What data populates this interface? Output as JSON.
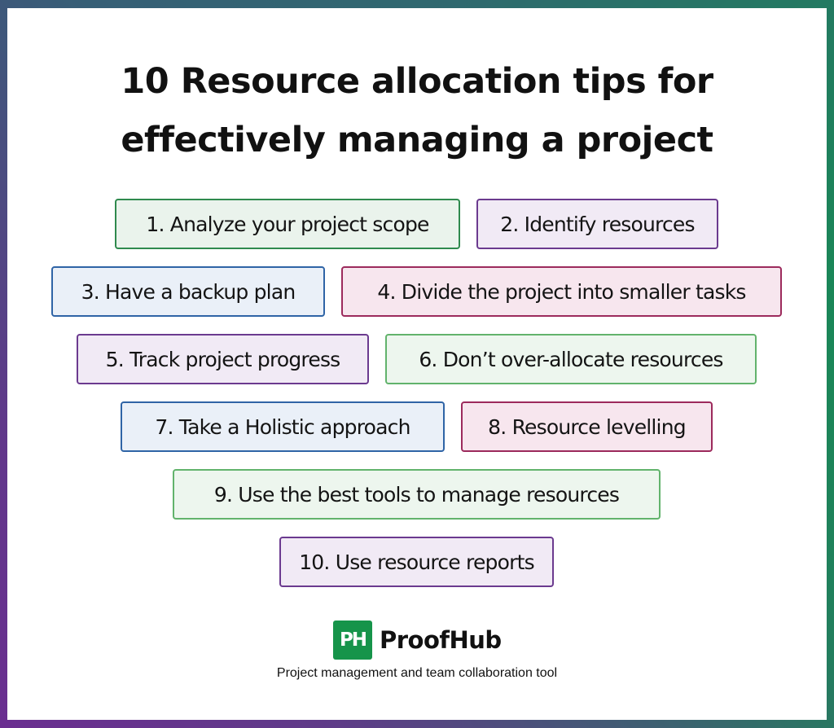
{
  "title": {
    "line1": "10 Resource allocation tips for",
    "line2": "effectively managing a project"
  },
  "tips": [
    {
      "label": "1.  Analyze your project scope",
      "color": "green"
    },
    {
      "label": "2.  Identify resources",
      "color": "purple"
    },
    {
      "label": "3.  Have a backup plan",
      "color": "blue"
    },
    {
      "label": "4.  Divide the project into smaller tasks",
      "color": "pink"
    },
    {
      "label": "5.  Track project progress",
      "color": "purple"
    },
    {
      "label": "6.  Don’t over-allocate resources",
      "color": "green"
    },
    {
      "label": "7.  Take a Holistic approach",
      "color": "blue"
    },
    {
      "label": "8.  Resource levelling",
      "color": "pink"
    },
    {
      "label": "9.   Use the best tools to manage resources",
      "color": "green"
    },
    {
      "label": "10. Use resource reports",
      "color": "purple"
    }
  ],
  "brand": {
    "logo_mark": "PH",
    "name": "ProofHub",
    "tagline": "Project management and team collaboration tool",
    "color": "#16944a"
  },
  "colors": {
    "border_top_left": "#2e6a6e",
    "border_top_right": "#0d9a48",
    "border_bottom_left": "#6a2e90",
    "tip_green_border": "#2f8a4e",
    "tip_purple_border": "#6b3a8f",
    "tip_blue_border": "#2f64a6",
    "tip_pink_border": "#9c2a5c"
  }
}
